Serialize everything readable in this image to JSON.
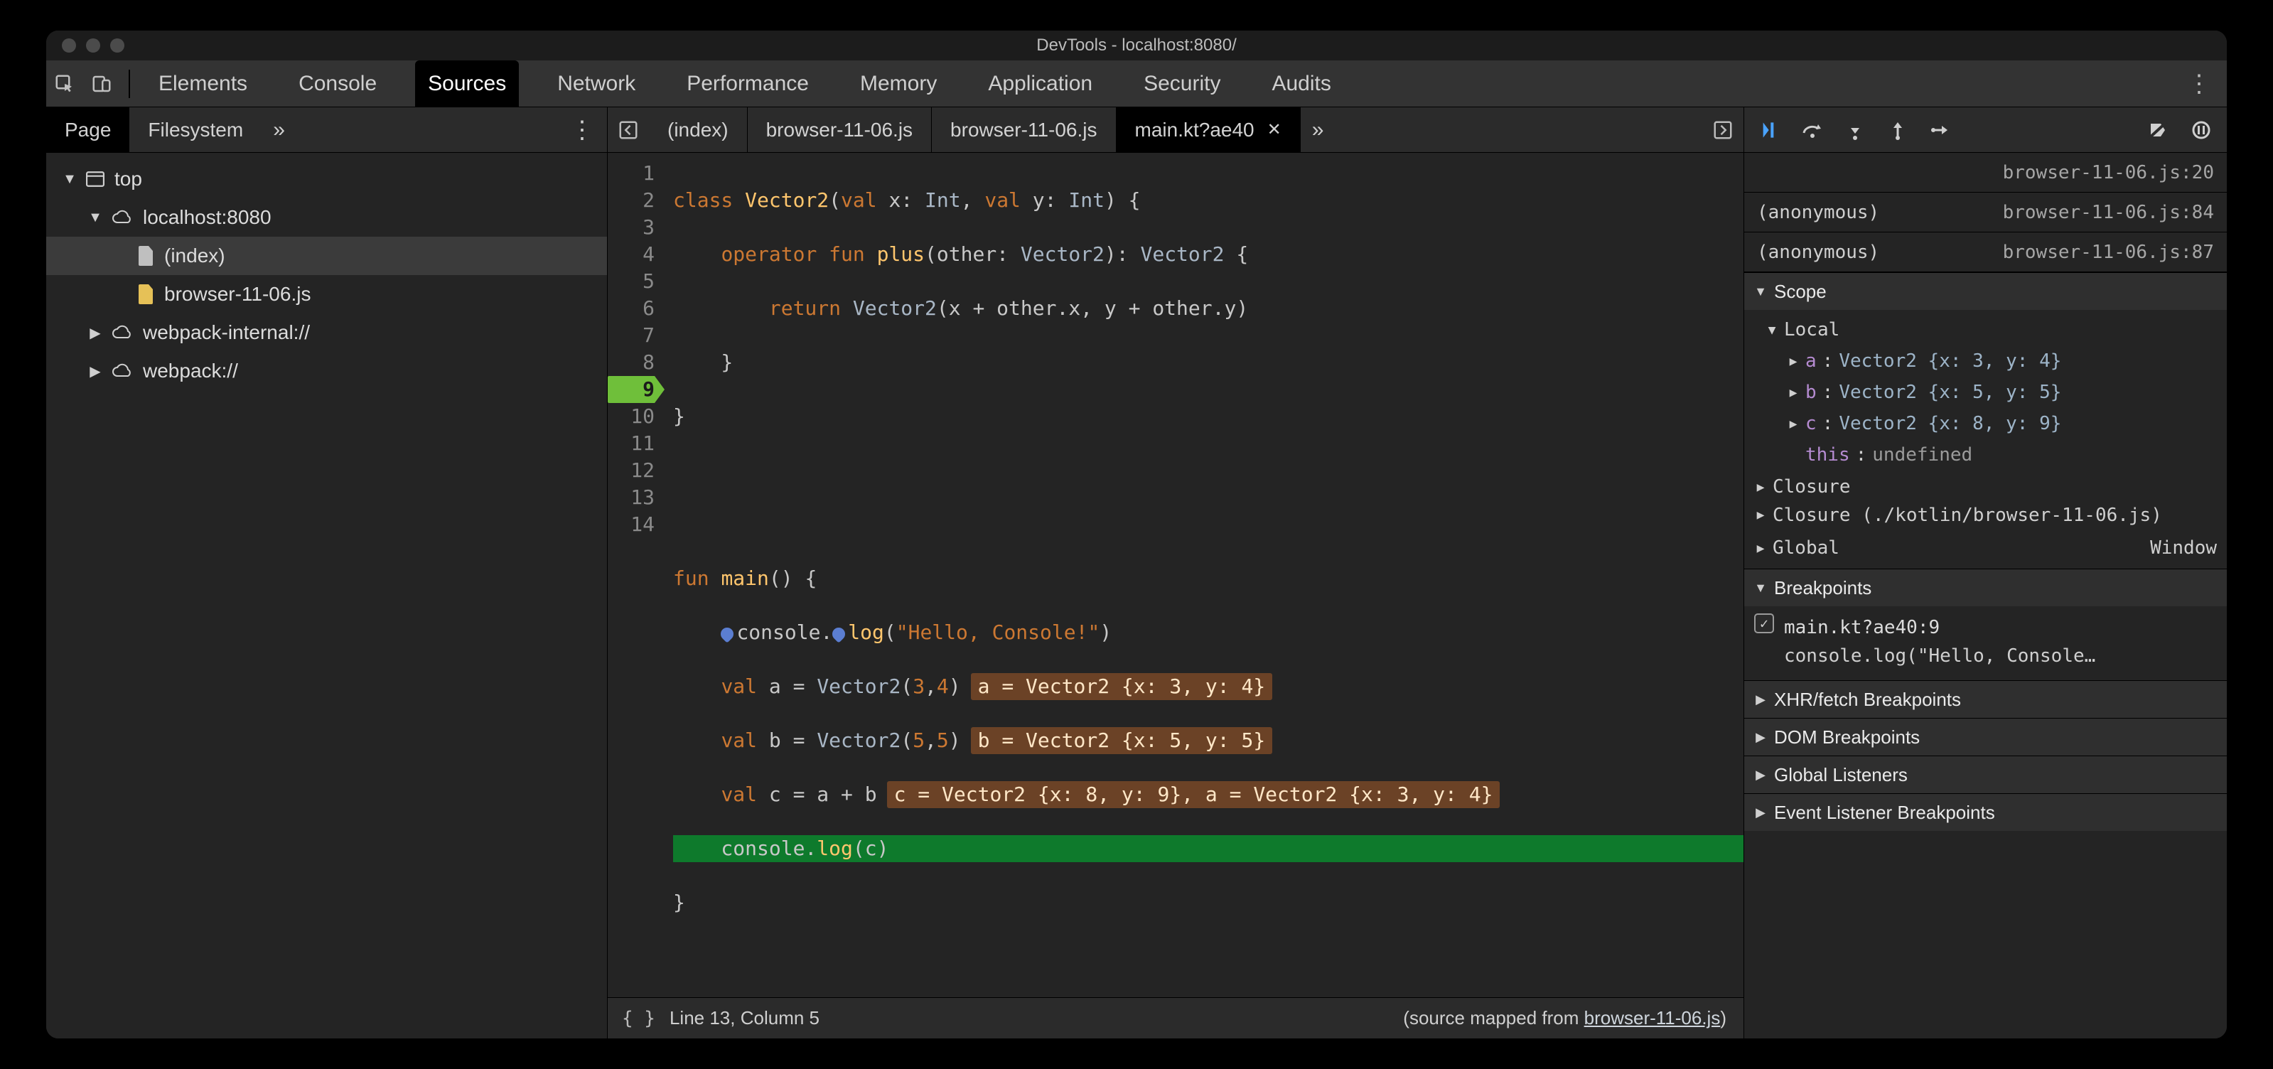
{
  "window": {
    "title": "DevTools - localhost:8080/"
  },
  "toolbar": {
    "panels": [
      "Elements",
      "Console",
      "Sources",
      "Network",
      "Performance",
      "Memory",
      "Application",
      "Security",
      "Audits"
    ],
    "active_index": 2
  },
  "left": {
    "tabs": [
      "Page",
      "Filesystem"
    ],
    "active_index": 0,
    "tree": {
      "top_label": "top",
      "host_label": "localhost:8080",
      "index_label": "(index)",
      "file_label": "browser-11-06.js",
      "wp_internal": "webpack-internal://",
      "wp": "webpack://"
    }
  },
  "file_tabs": {
    "items": [
      "(index)",
      "browser-11-06.js",
      "browser-11-06.js",
      "main.kt?ae40"
    ],
    "active_index": 3
  },
  "editor": {
    "lines": 14,
    "breakpoint_line": 9,
    "highlight_line": 13,
    "code": {
      "l1": {
        "kw1": "class",
        "type": "Vector2",
        "rest": "(",
        "kw2": "val",
        "x": " x: ",
        "int1": "Int",
        ", ": "",
        "kw3": "val",
        "y": " y: ",
        "int2": "Int",
        ") {": ""
      },
      "raw1": "class Vector2(val x: Int, val y: Int) {",
      "raw2": "    operator fun plus(other: Vector2): Vector2 {",
      "raw3": "        return Vector2(x + other.x, y + other.y)",
      "raw4": "    }",
      "raw5": "}",
      "raw6": "",
      "raw7": "",
      "raw8": "fun main() {",
      "raw9": "    console.log(\"Hello, Console!\")",
      "raw10": "    val a = Vector2(3,4)",
      "raw11": "    val b = Vector2(5,5)",
      "raw12": "    val c = a + b",
      "raw13": "    console.log(c)",
      "raw14": "}"
    },
    "inline": {
      "l10": "a = Vector2 {x: 3, y: 4}",
      "l11": "b = Vector2 {x: 5, y: 5}",
      "l12": "c = Vector2 {x: 8, y: 9}, a = Vector2 {x: 3, y: 4}"
    }
  },
  "statusbar": {
    "pos": "Line 13, Column 5",
    "map_prefix": "(source mapped from ",
    "map_link": "browser-11-06.js",
    "map_suffix": ")"
  },
  "debugger": {
    "stack": {
      "first_loc": "browser-11-06.js:20",
      "rows": [
        {
          "name": "(anonymous)",
          "loc": "browser-11-06.js:84"
        },
        {
          "name": "(anonymous)",
          "loc": "browser-11-06.js:87"
        }
      ]
    },
    "scope": {
      "title": "Scope",
      "local_label": "Local",
      "vars": [
        {
          "name": "a",
          "repr": "Vector2 {x: 3, y: 4}"
        },
        {
          "name": "b",
          "repr": "Vector2 {x: 5, y: 5}"
        },
        {
          "name": "c",
          "repr": "Vector2 {x: 8, y: 9}"
        }
      ],
      "this_label": "this",
      "this_val": "undefined",
      "closure_label": "Closure",
      "closure2": "Closure (./kotlin/browser-11-06.js)",
      "global_label": "Global",
      "global_val": "Window"
    },
    "breakpoints": {
      "title": "Breakpoints",
      "item_title": "main.kt?ae40:9",
      "item_code": "console.log(\"Hello, Console…"
    },
    "sections": {
      "xhr": "XHR/fetch Breakpoints",
      "dom": "DOM Breakpoints",
      "gl": "Global Listeners",
      "ev": "Event Listener Breakpoints"
    }
  }
}
